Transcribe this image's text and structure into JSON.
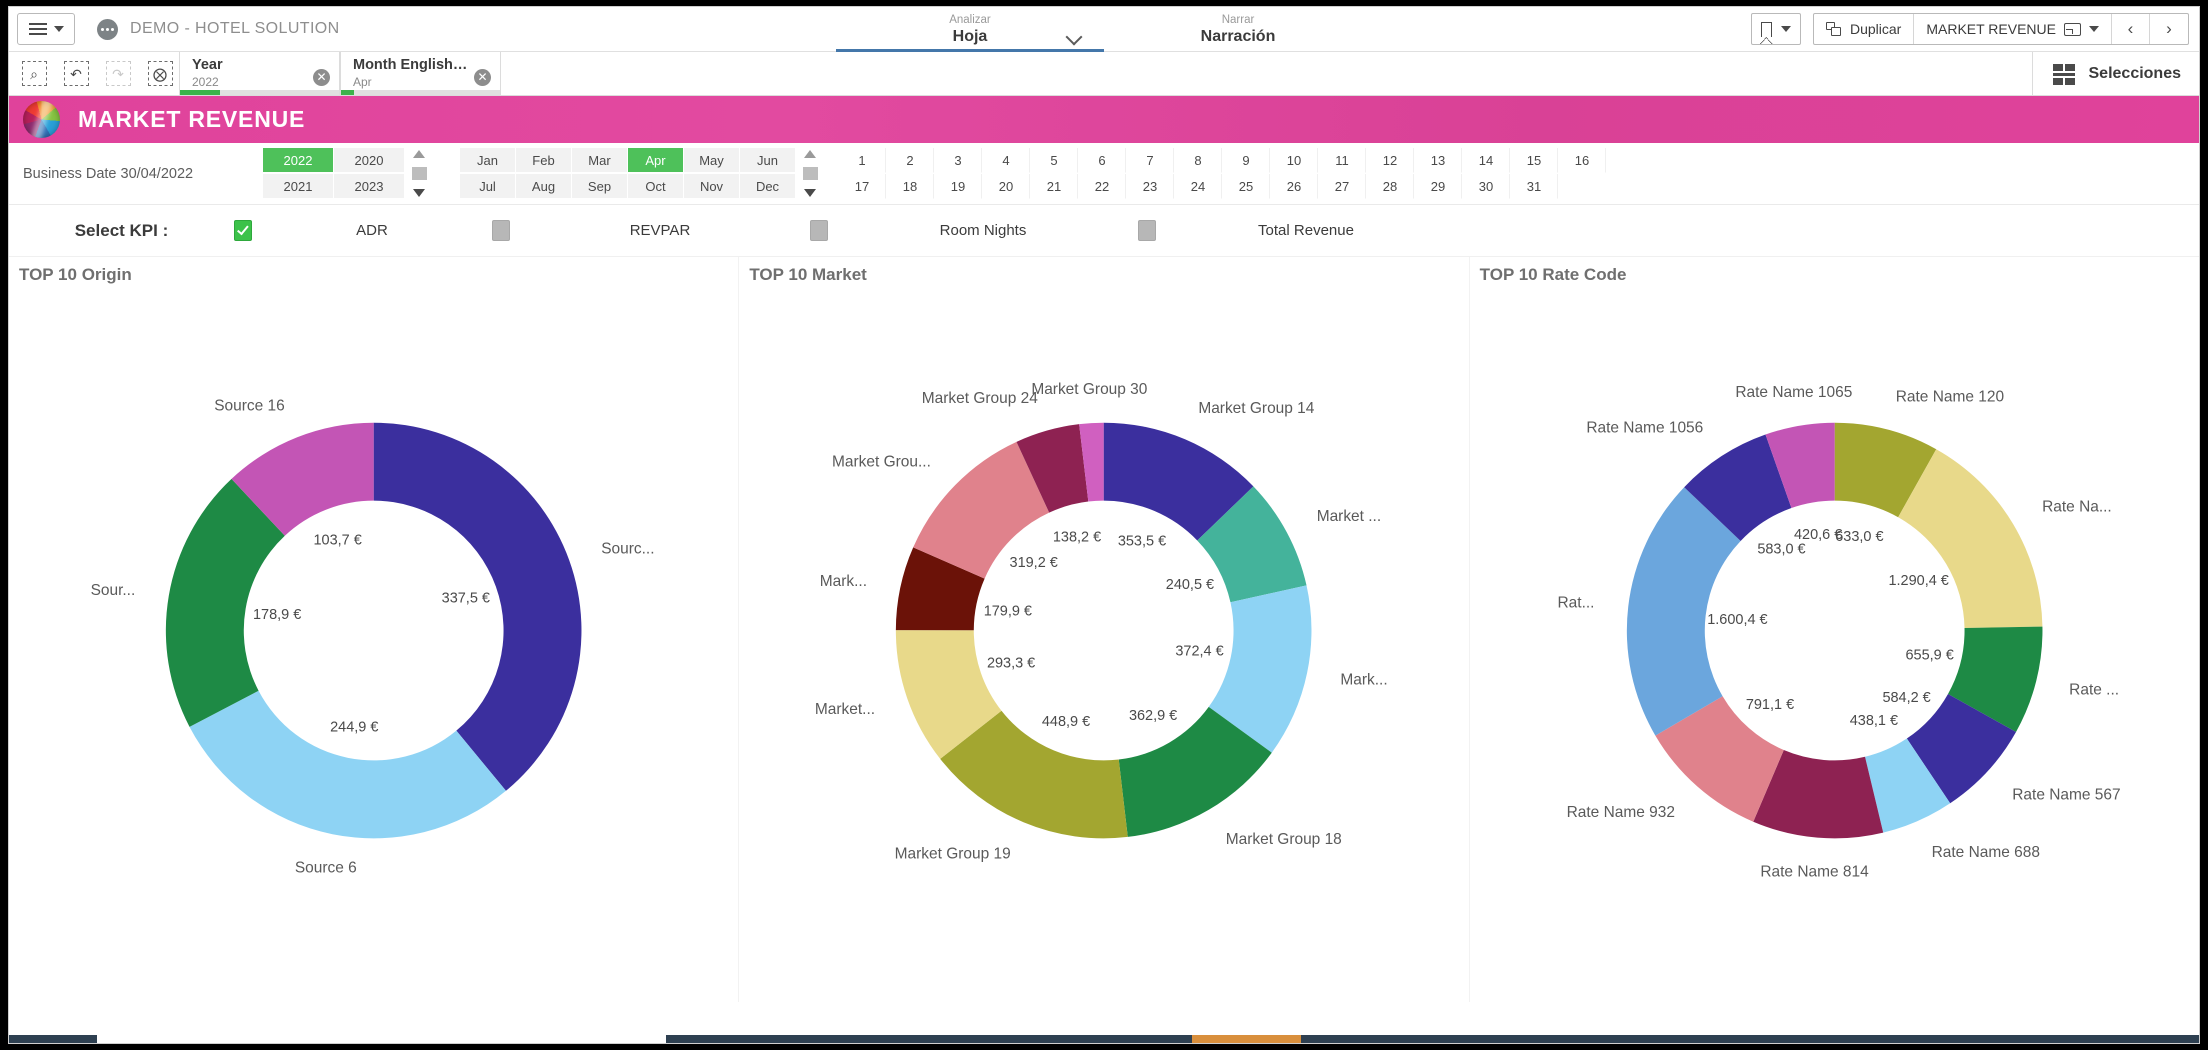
{
  "topbar": {
    "menu_icon": "hamburger-icon",
    "menu_caret": "chevron-down-icon",
    "app_icon": "app-dots-icon",
    "app_title": "DEMO - HOTEL SOLUTION",
    "nav": [
      {
        "small": "Analizar",
        "big": "Hoja",
        "active": true
      },
      {
        "small": "Narrar",
        "big": "Narración",
        "active": false
      }
    ],
    "bookmark_label": "",
    "duplicate_label": "Duplicar",
    "sheet_label": "MARKET REVENUE",
    "prev_label": "‹",
    "next_label": "›"
  },
  "selectionbar": {
    "tools": [
      {
        "name": "selection-search-icon",
        "glyph": "⌕",
        "enabled": true
      },
      {
        "name": "step-back-icon",
        "glyph": "↶",
        "enabled": true
      },
      {
        "name": "step-forward-icon",
        "glyph": "↷",
        "enabled": false
      },
      {
        "name": "clear-selections-icon",
        "glyph": "⊗",
        "enabled": true
      }
    ],
    "chips": [
      {
        "field": "Year",
        "value": "2022",
        "fill_pct": 25
      },
      {
        "field": "Month English S...",
        "value": "Apr",
        "fill_pct": 8
      }
    ],
    "selections_label": "Selecciones"
  },
  "banner": {
    "logo": "qlik-ball-logo",
    "title": "MARKET REVENUE",
    "color": "#e0429b"
  },
  "filters": {
    "business_date_label": "Business Date 30/04/2022",
    "years": [
      {
        "label": "2022",
        "selected": true
      },
      {
        "label": "2020",
        "selected": false
      },
      {
        "label": "2021",
        "selected": false
      },
      {
        "label": "2023",
        "selected": false
      }
    ],
    "months": [
      {
        "label": "Jan",
        "selected": false
      },
      {
        "label": "Feb",
        "selected": false
      },
      {
        "label": "Mar",
        "selected": false
      },
      {
        "label": "Apr",
        "selected": true
      },
      {
        "label": "May",
        "selected": false
      },
      {
        "label": "Jun",
        "selected": false
      },
      {
        "label": "Jul",
        "selected": false
      },
      {
        "label": "Aug",
        "selected": false
      },
      {
        "label": "Sep",
        "selected": false
      },
      {
        "label": "Oct",
        "selected": false
      },
      {
        "label": "Nov",
        "selected": false
      },
      {
        "label": "Dec",
        "selected": false
      }
    ],
    "days": [
      "1",
      "2",
      "3",
      "4",
      "5",
      "6",
      "7",
      "8",
      "9",
      "10",
      "11",
      "12",
      "13",
      "14",
      "15",
      "16",
      "17",
      "18",
      "19",
      "20",
      "21",
      "22",
      "23",
      "24",
      "25",
      "26",
      "27",
      "28",
      "29",
      "30",
      "31"
    ],
    "selected_color": "#4ec15a"
  },
  "kpi": {
    "title": "Select KPI :",
    "items": [
      {
        "label": "ADR",
        "checked": true
      },
      {
        "label": "REVPAR",
        "checked": false
      },
      {
        "label": "Room Nights",
        "checked": false
      },
      {
        "label": "Total Revenue",
        "checked": false
      }
    ]
  },
  "chart_data": [
    {
      "type": "pie",
      "title": "TOP 10 Origin",
      "hole": 0.62,
      "unit": "€",
      "labels": [
        "Sourc...",
        "Source 6",
        "Sour...",
        "Source 16"
      ],
      "values": [
        337.5,
        244.9,
        178.9,
        103.7
      ],
      "value_labels": [
        "337,5 €",
        "244,9 €",
        "178,9 €",
        "103,7 €"
      ],
      "colors": [
        "#3b2f9e",
        "#8ed3f4",
        "#1e8a45",
        "#c355b5"
      ],
      "legend": "none"
    },
    {
      "type": "pie",
      "title": "TOP 10 Market",
      "hole": 0.62,
      "unit": "€",
      "labels": [
        "Market Group 14",
        "Market ...",
        "Mark...",
        "Market Group 18",
        "Market Group 19",
        "Market...",
        "Mark...",
        "Market Grou...",
        "Market Group 24",
        "Market Group 30"
      ],
      "values": [
        353.5,
        240.5,
        372.4,
        362.9,
        448.9,
        293.3,
        179.9,
        319.2,
        138.2,
        52.0
      ],
      "value_labels": [
        "353,5 €",
        "240,5 €",
        "372,4 €",
        "362,9 €",
        "448,9 €",
        "293,3 €",
        "179,9 €",
        "319,2 €",
        "138,2 €",
        ""
      ],
      "colors": [
        "#3b2f9e",
        "#44b39b",
        "#8ed3f4",
        "#1e8a45",
        "#a3a630",
        "#e8d98a",
        "#6b1208",
        "#e0828c",
        "#8e2252",
        "#d060c0"
      ],
      "legend": "none"
    },
    {
      "type": "pie",
      "title": "TOP 10 Rate Code",
      "hole": 0.62,
      "unit": "€",
      "labels": [
        "Rate Name 120",
        "Rate Na...",
        "Rate ...",
        "Rate Name 567",
        "Rate Name 688",
        "Rate Name 814",
        "Rate Name 932",
        "Rat...",
        "Rate Name 1056",
        "Rate Name 1065"
      ],
      "values": [
        633.0,
        1290.4,
        655.9,
        584.2,
        438.1,
        791.1,
        791.1,
        1600.4,
        583.0,
        420.6
      ],
      "value_labels": [
        "633,0 €",
        "1.290,4 €",
        "655,9 €",
        "584,2 €",
        "438,1 €",
        "",
        "791,1 €",
        "1.600,4 €",
        "583,0 €",
        "420,6 €"
      ],
      "colors": [
        "#a3a630",
        "#e8d98a",
        "#1e8a45",
        "#3b2f9e",
        "#8ed3f4",
        "#8e2252",
        "#e0828c",
        "#6ba6dd",
        "#3b2f9e",
        "#c355b5"
      ],
      "legend": "none"
    }
  ]
}
